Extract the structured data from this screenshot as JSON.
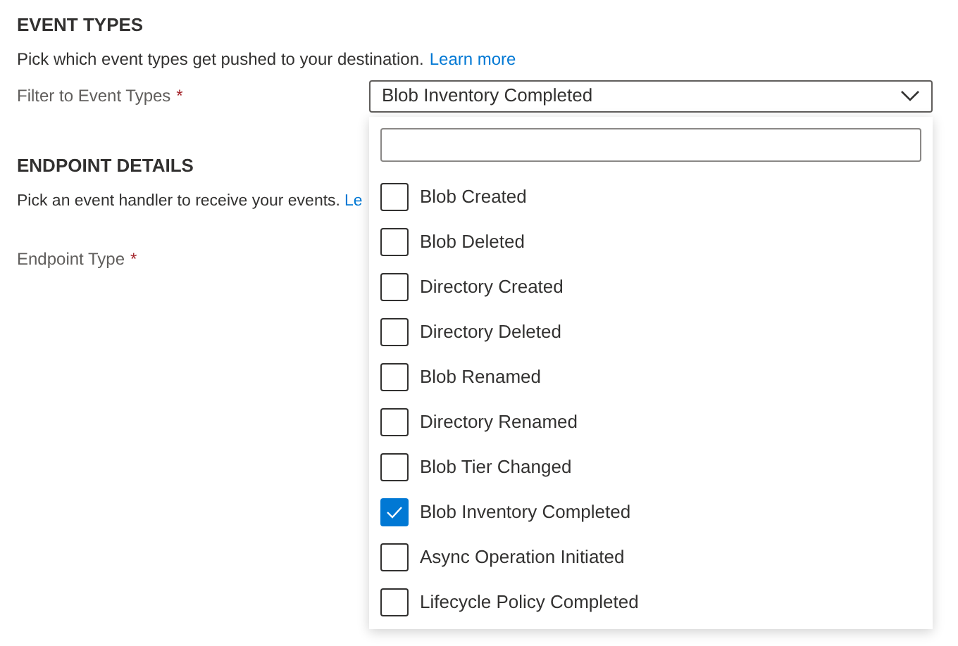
{
  "event_types": {
    "heading": "EVENT TYPES",
    "description": "Pick which event types get pushed to your destination.",
    "link": "Learn more",
    "filter_label": "Filter to Event Types",
    "required_mark": "*",
    "dropdown": {
      "value": "Blob Inventory Completed",
      "expanded": true,
      "options": [
        {
          "label": "Blob Created",
          "checked": false
        },
        {
          "label": "Blob Deleted",
          "checked": false
        },
        {
          "label": "Directory Created",
          "checked": false
        },
        {
          "label": "Directory Deleted",
          "checked": false
        },
        {
          "label": "Blob Renamed",
          "checked": false
        },
        {
          "label": "Directory Renamed",
          "checked": false
        },
        {
          "label": "Blob Tier Changed",
          "checked": false
        },
        {
          "label": "Blob Inventory Completed",
          "checked": true
        },
        {
          "label": "Async Operation Initiated",
          "checked": false
        },
        {
          "label": "Lifecycle Policy Completed",
          "checked": false
        }
      ]
    }
  },
  "endpoint_details": {
    "heading": "ENDPOINT DETAILS",
    "description": "Pick an event handler to receive your events.",
    "link": "Le",
    "type_label": "Endpoint Type",
    "required_mark": "*"
  }
}
